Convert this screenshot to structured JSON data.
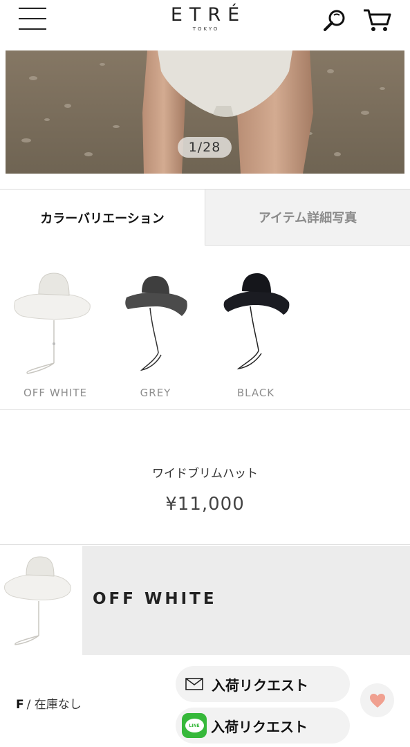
{
  "header": {
    "logo": "ETRÉ",
    "logo_sub": "TOKYO",
    "icons": {
      "menu": "hamburger-menu-icon",
      "search": "search-icon",
      "cart": "cart-icon"
    }
  },
  "gallery": {
    "counter": "1/28"
  },
  "tabs": [
    {
      "label": "カラーバリエーション",
      "active": true
    },
    {
      "label": "アイテム詳細写真",
      "active": false
    }
  ],
  "variations": [
    {
      "label": "OFF WHITE",
      "swatch": "#ecebe8"
    },
    {
      "label": "GREY",
      "swatch": "#4a4a4a"
    },
    {
      "label": "BLACK",
      "swatch": "#1a1b22"
    }
  ],
  "product": {
    "name": "ワイドブリムハット",
    "price": "¥11,000"
  },
  "selected": {
    "color_name": "OFF WHITE"
  },
  "stock": {
    "size": "F",
    "separator": "/",
    "status": "在庫なし",
    "mail_request": "入荷リクエスト",
    "line_request": "入荷リクエスト",
    "line_badge": "LINE"
  },
  "colors": {
    "accent_heart": "#f0a090",
    "line_green": "#36b83a",
    "button_bg": "#f2f2f2"
  }
}
